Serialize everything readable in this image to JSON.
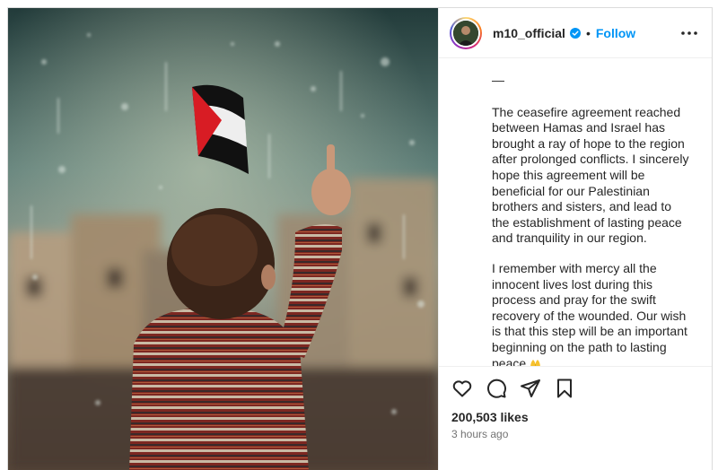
{
  "post": {
    "username": "m10_official",
    "follow_label": "Follow",
    "separator": "•",
    "caption": {
      "dash": "—",
      "paragraph1": "The ceasefire agreement reached between Hamas and Israel has brought a ray of hope to the region after prolonged conflicts. I sincerely hope this agreement will be beneficial for our Palestinian brothers and sisters, and lead to the establishment of lasting peace and tranquility in our region.",
      "paragraph2": "I remember with mercy all the innocent lives lost during this process and pray for the swift recovery of the wounded. Our wish is that this step will be an important beginning on the path to lasting peace",
      "emoji": "praying-hands-emoji",
      "time": "3h"
    },
    "likes": "200,503 likes",
    "posted_ago": "3 hours ago"
  },
  "icons": {
    "verified": "verified-badge-icon",
    "more": "more-options-icon",
    "like": "heart-icon",
    "comment": "comment-icon",
    "share": "share-icon",
    "save": "bookmark-icon"
  },
  "colors": {
    "accent": "#0095f6",
    "text": "#262626",
    "muted": "#737373",
    "border": "#dbdbdb"
  }
}
